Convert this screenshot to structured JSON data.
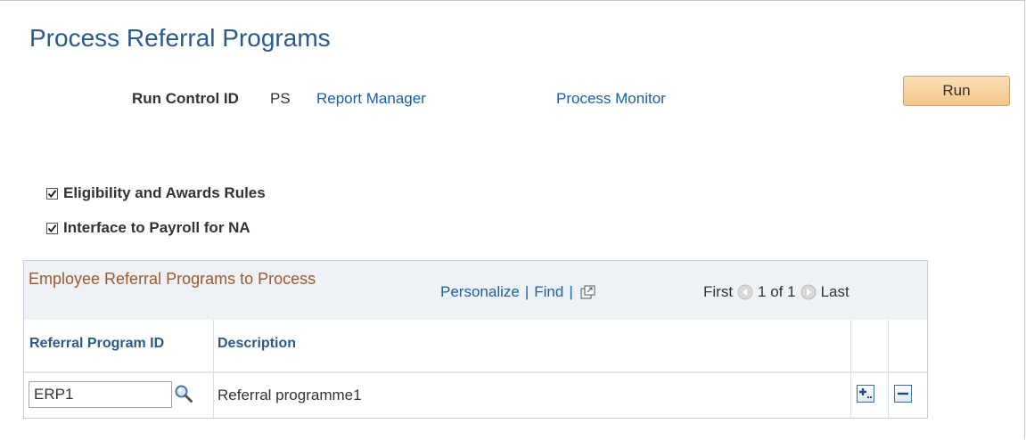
{
  "page": {
    "title": "Process Referral Programs"
  },
  "run_control": {
    "label": "Run Control ID",
    "value": "PS",
    "report_manager": "Report Manager",
    "process_monitor": "Process Monitor",
    "run_button": "Run"
  },
  "options": [
    {
      "label": "Eligibility and Awards Rules",
      "checked": true
    },
    {
      "label": "Interface to Payroll for NA",
      "checked": true
    }
  ],
  "grid": {
    "title": "Employee Referral Programs to Process",
    "personalize": "Personalize",
    "separator": "|",
    "find": "Find",
    "pager": {
      "first": "First",
      "range": "1 of 1",
      "last": "Last"
    },
    "columns": [
      "Referral Program ID",
      "Description"
    ],
    "rows": [
      {
        "program_id": "ERP1",
        "description": "Referral programme1"
      }
    ],
    "colors": {
      "title": "#9c5a2b",
      "header": "#2a5a8c",
      "link": "#1b5fa8"
    },
    "icons": [
      "view-all-icon",
      "previous-icon",
      "next-icon",
      "lookup-icon",
      "add-row-icon",
      "delete-row-icon"
    ]
  }
}
